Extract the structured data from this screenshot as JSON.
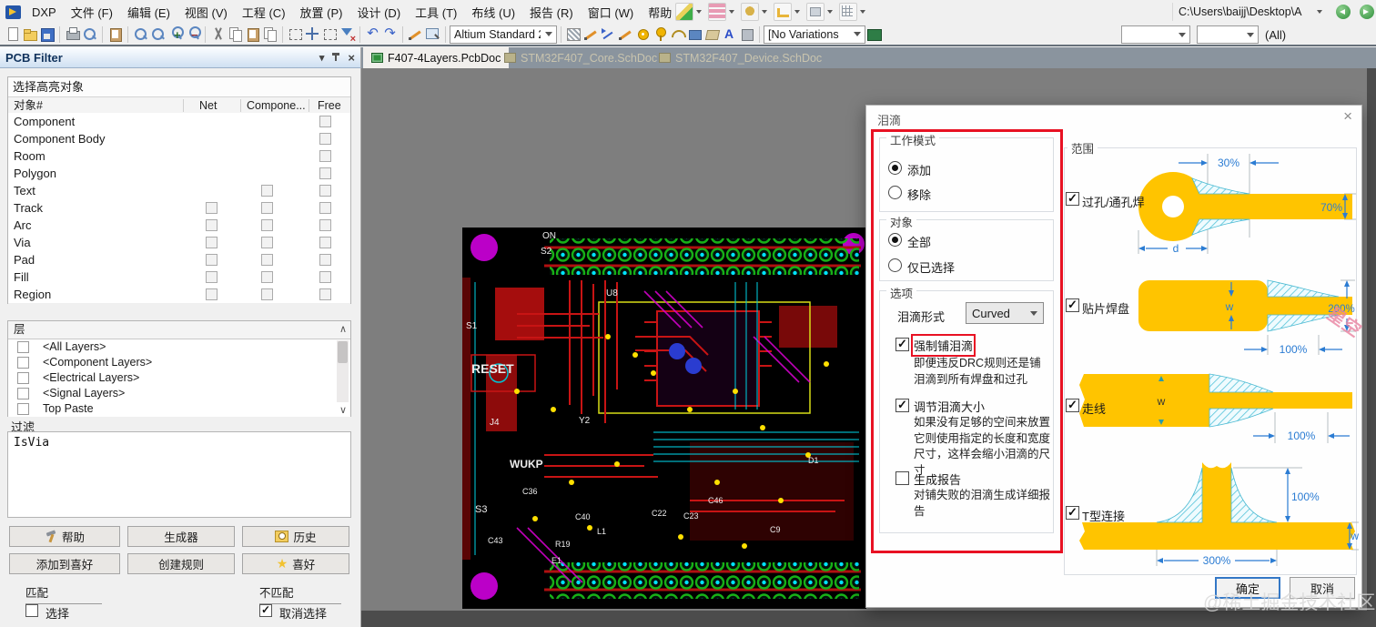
{
  "menu_bar": {
    "items": [
      "DXP",
      "文件 (F)",
      "编辑 (E)",
      "视图 (V)",
      "工程 (C)",
      "放置 (P)",
      "设计 (D)",
      "工具 (T)",
      "布线 (U)",
      "报告 (R)",
      "窗口 (W)",
      "帮助 (H)"
    ]
  },
  "address_bar": {
    "path": "C:\\Users\\baijj\\Desktop\\A"
  },
  "toolbar": {
    "layout_combo": "Altium Standard 2",
    "variations_combo": "[No Variations",
    "scope_combo": "(All)"
  },
  "tabs": [
    {
      "label": "F407-4Layers.PcbDoc"
    },
    {
      "label": "STM32F407_Core.SchDoc"
    },
    {
      "label": "STM32F407_Device.SchDoc"
    }
  ],
  "pcb_filter": {
    "title": "PCB Filter",
    "section_header": "选择高亮对象",
    "columns": [
      "对象#",
      "Net",
      "Compone...",
      "Free"
    ],
    "rows": [
      {
        "name": "Component"
      },
      {
        "name": "Component Body"
      },
      {
        "name": "Room"
      },
      {
        "name": "Polygon"
      },
      {
        "name": "Text"
      },
      {
        "name": "Track"
      },
      {
        "name": "Arc"
      },
      {
        "name": "Via"
      },
      {
        "name": "Pad"
      },
      {
        "name": "Fill"
      },
      {
        "name": "Region"
      }
    ],
    "layers": {
      "header": "层",
      "items": [
        "<All Layers>",
        "<Component Layers>",
        "<Electrical Layers>",
        "<Signal Layers>",
        "Top Paste"
      ]
    },
    "filter": {
      "label": "过滤",
      "value": "IsVia"
    },
    "buttons": {
      "help": "帮助",
      "builder": "生成器",
      "history": "历史",
      "add_favorite": "添加到喜好",
      "create_rule": "创建规则",
      "favorites": "喜好"
    },
    "match": {
      "label": "匹配",
      "checkbox": "选择"
    },
    "no_match": {
      "label": "不匹配",
      "checkbox": "取消选择"
    }
  },
  "pcb": {
    "labels": [
      "RESET",
      "WUKP",
      "ON",
      "S2",
      "S1",
      "S3",
      "J4",
      "U8",
      "Y2",
      "C36",
      "C40",
      "R19",
      "C22",
      "C23",
      "C9",
      "D1",
      "L1",
      "E1",
      "C43",
      "C46"
    ]
  },
  "dialog": {
    "title": "泪滴",
    "work_mode": {
      "label": "工作模式",
      "add": "添加",
      "remove": "移除"
    },
    "objects": {
      "label": "对象",
      "all": "全部",
      "selected_only": "仅已选择"
    },
    "options": {
      "label": "选项",
      "style_label": "泪滴形式",
      "style_value": "Curved",
      "force": {
        "label": "强制铺泪滴",
        "desc": "即便违反DRC规则还是铺泪滴到所有焊盘和过孔"
      },
      "adjust": {
        "label": "调节泪滴大小",
        "desc": "如果没有足够的空间来放置它则使用指定的长度和宽度尺寸，这样会缩小泪滴的尺寸"
      },
      "report": {
        "label": "生成报告",
        "desc": "对铺失败的泪滴生成详细报告"
      }
    },
    "scope": {
      "label": "范围",
      "via": {
        "label": "过孔/通孔焊",
        "dim_top": "30%",
        "dim_right": "70%",
        "dim_bottom": "d"
      },
      "smd": {
        "label": "贴片焊盘",
        "dim_w": "w",
        "dim_right": "200%",
        "dim_bottom": "100%"
      },
      "track": {
        "label": "走线",
        "dim_w": "w",
        "dim_bottom": "100%"
      },
      "tee": {
        "label": "T型连接",
        "dim_right": "100%",
        "dim_w": "w",
        "dim_bottom": "300%"
      }
    },
    "ok": "确定",
    "cancel": "取消"
  },
  "icons": {
    "dropdown": "▾",
    "close": "×",
    "up": "∧",
    "down": "∨",
    "star": "★"
  },
  "watermarks": {
    "bottom": "@稀土掘金技术社区",
    "side": "星空"
  },
  "colors": {
    "accent_red": "#e81123",
    "teardrop_yellow": "#ffc400",
    "dim_blue": "#2b7cd3",
    "hatch_cyan": "#6fd3e4"
  }
}
